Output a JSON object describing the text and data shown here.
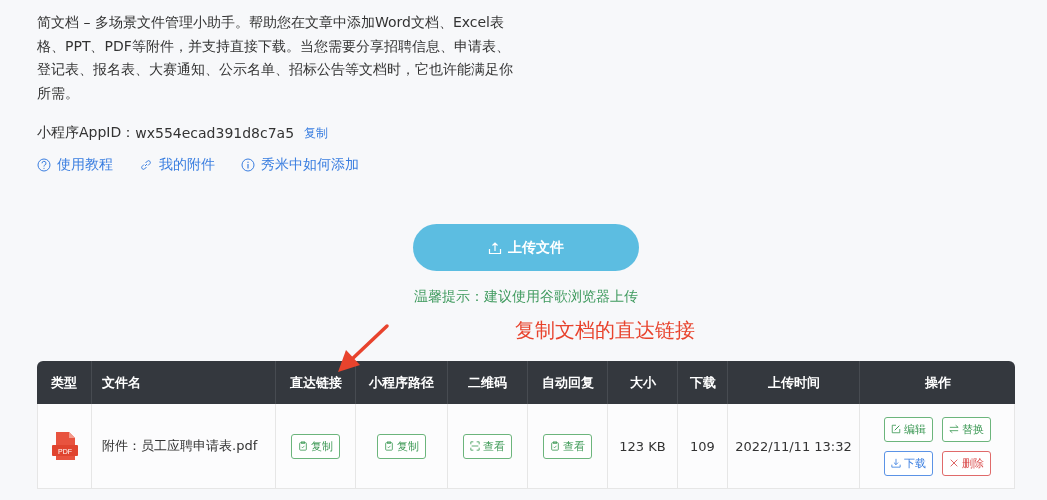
{
  "intro": "简文档 – 多场景文件管理小助手。帮助您在文章中添加Word文档、Excel表格、PPT、PDF等附件，并支持直接下载。当您需要分享招聘信息、申请表、登记表、报名表、大赛通知、公示名单、招标公告等文档时，它也许能满足你所需。",
  "appid": {
    "label": "小程序AppID：",
    "value": "wx554ecad391d8c7a5",
    "copy": "复制"
  },
  "links": [
    {
      "kind": "help",
      "label": "使用教程"
    },
    {
      "kind": "link",
      "label": "我的附件"
    },
    {
      "kind": "info",
      "label": "秀米中如何添加"
    }
  ],
  "upload_button": "上传文件",
  "tip": "温馨提示：建议使用谷歌浏览器上传",
  "annotation": "复制文档的直达链接",
  "table": {
    "columns": [
      "类型",
      "文件名",
      "直达链接",
      "小程序路径",
      "二维码",
      "自动回复",
      "大小",
      "下载",
      "上传时间",
      "操作"
    ],
    "rows": [
      {
        "kind": "pdf",
        "type_label": "PDF",
        "name": "附件：员工应聘申请表.pdf",
        "direct_link": {
          "kind": "clipboard",
          "label": "复制"
        },
        "path": {
          "kind": "clipboard",
          "label": "复制"
        },
        "qrcode": {
          "kind": "scan",
          "label": "查看"
        },
        "auto_reply": {
          "kind": "clipboard",
          "label": "查看"
        },
        "size": "123 KB",
        "downloads": "109",
        "time": "2022/11/11 13:32",
        "actions": [
          {
            "kind": "edit",
            "label": "编辑"
          },
          {
            "kind": "replace",
            "label": "替换"
          },
          {
            "kind": "download",
            "label": "下载"
          },
          {
            "kind": "delete",
            "label": "删除"
          }
        ]
      }
    ]
  }
}
